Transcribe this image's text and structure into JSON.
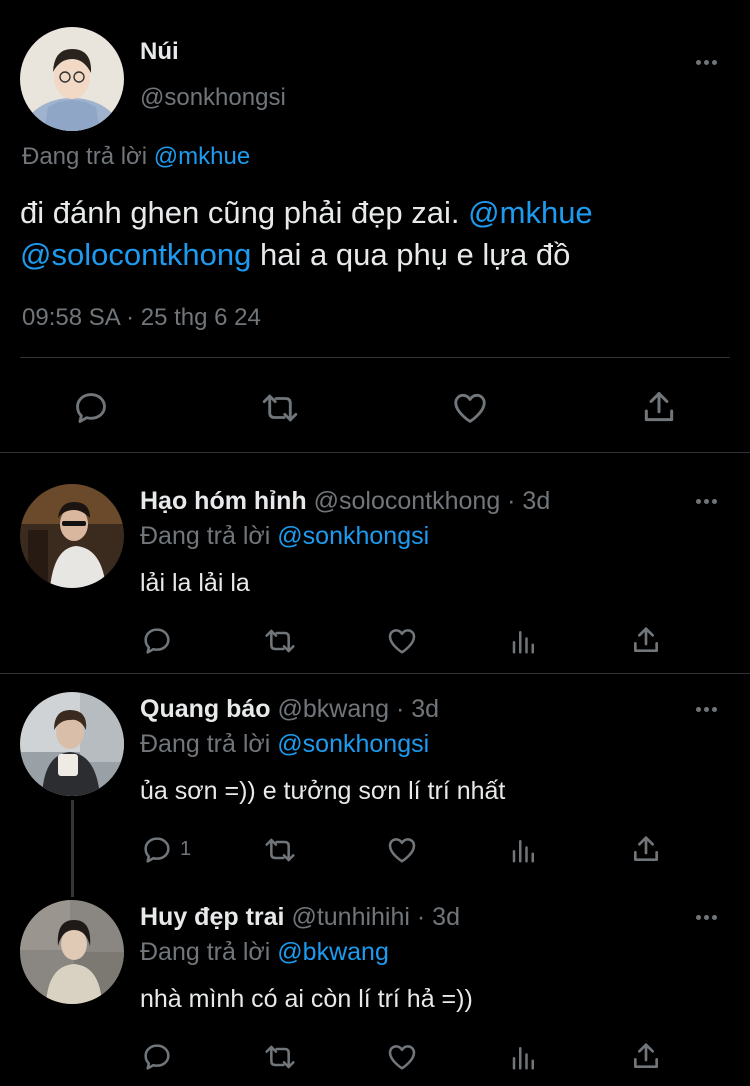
{
  "colors": {
    "background": "#000000",
    "text": "#e7e9ea",
    "muted": "#71767b",
    "accent": "#1d9bf0",
    "divider": "#2f3336"
  },
  "main_tweet": {
    "name": "Núi",
    "handle": "@sonkhongsi",
    "reply_prefix": "Đang trả lời",
    "reply_to": "@mkhue",
    "text_a": "đi đánh ghen cũng phải đẹp zai.",
    "mention_1": "@mkhue",
    "mention_2": "@solocontkhong",
    "text_b": "hai a qua phụ e lựa đồ",
    "timestamp": "09:58 SA · 25 thg 6 24",
    "actions": [
      "reply-icon",
      "retweet-icon",
      "like-icon",
      "share-icon"
    ]
  },
  "replies": [
    {
      "name": "Hạo hóm hỉnh",
      "handle": "@solocontkhong · 3d",
      "reply_prefix": "Đang trả lời",
      "reply_to": "@sonkhongsi",
      "text": "lải la lải la",
      "reply_count": ""
    },
    {
      "name": "Quang báo",
      "handle": "@bkwang · 3d",
      "reply_prefix": "Đang trả lời",
      "reply_to": "@sonkhongsi",
      "text": "ủa sơn =)) e tưởng sơn lí trí nhất",
      "reply_count": "1"
    },
    {
      "name": "Huy đẹp trai",
      "handle": "@tunhihihi · 3d",
      "reply_prefix": "Đang trả lời",
      "reply_to": "@bkwang",
      "text": "nhà mình có ai còn lí trí hả =))",
      "reply_count": ""
    }
  ]
}
